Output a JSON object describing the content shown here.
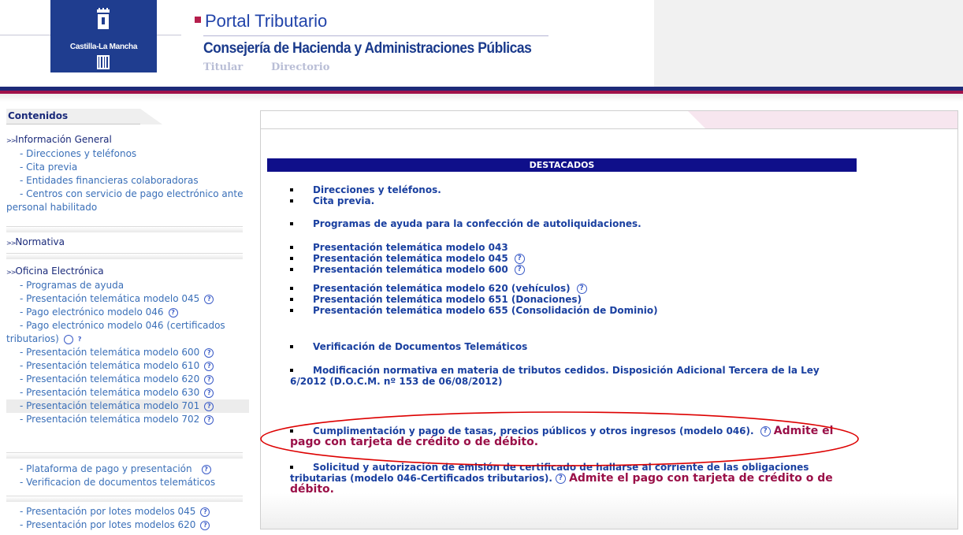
{
  "header": {
    "logo_text": "Castilla-La Mancha",
    "portal_title": "Portal Tributario",
    "subtitle": "Consejería de Hacienda y Administraciones Públicas",
    "nav": [
      "Titular",
      "Directorio"
    ]
  },
  "sidebar": {
    "title": "Contenidos",
    "groups": [
      {
        "heading": "Información General",
        "items": [
          {
            "label": "- Direcciones y teléfonos"
          },
          {
            "label": "- Cita previa"
          },
          {
            "label": "- Entidades financieras colaboradoras"
          },
          {
            "label": "- Centros con servicio de pago electrónico ante personal habilitado"
          }
        ]
      },
      {
        "heading": "Normativa",
        "items": []
      },
      {
        "heading": "Oficina Electrónica",
        "items": [
          {
            "label": "- Programas de ayuda"
          },
          {
            "label": "- Presentación telemática modelo 045"
          },
          {
            "label": "- Pago electrónico modelo 046"
          },
          {
            "label": "- Pago electrónico modelo 046 (certificados tributarios)"
          },
          {
            "label": "- Presentación telemática modelo 600"
          },
          {
            "label": "- Presentación telemática modelo 610"
          },
          {
            "label": "- Presentación telemática modelo 620"
          },
          {
            "label": "- Presentación telemática modelo 630"
          },
          {
            "label": "- Presentación telemática modelo 701"
          },
          {
            "label": "- Presentación telemática modelo 702"
          }
        ]
      },
      {
        "heading": "",
        "items": [
          {
            "label": "- Plataforma de pago y presentación"
          },
          {
            "label": "- Verificacion de documentos telemáticos"
          }
        ]
      },
      {
        "heading": "",
        "items": [
          {
            "label": "- Presentación por lotes modelos 045"
          },
          {
            "label": "- Presentación por lotes modelos 620"
          }
        ]
      }
    ]
  },
  "main": {
    "destacados": "DESTACADOS",
    "links": {
      "direcciones": "Direcciones y teléfonos.",
      "cita": "Cita previa.",
      "programas": "Programas de ayuda para la confección de autoliquidaciones.",
      "m043": "Presentación telemática modelo 043",
      "m045": "Presentación telemática modelo 045",
      "m600": "Presentación telemática modelo 600",
      "m620": "Presentación telemática modelo 620 (vehículos)",
      "m651": "Presentación telemática modelo 651 (Donaciones)",
      "m655": "Presentación telemática modelo 655 (Consolidación de Dominio)",
      "verificacion": "Verificación de Documentos Telemáticos",
      "modificacion": "Modificación normativa en materia de tributos cedidos. Disposición Adicional Tercera de la Ley 6/2012 (D.O.C.M. nº 153 de 06/08/2012)",
      "tasas": "Cumplimentación y pago de tasas, precios públicos y otros ingresos (modelo 046).",
      "tasas_note": "Admite el pago con tarjeta de crédito o de débito.",
      "solicitud": "Solicitud y autorización de emisión de certificado de hallarse al corriente de las obligaciones tributarias (modelo 046-Certificados tributarios).",
      "solicitud_note": "Admite el pago con tarjeta de crédito o de débito."
    }
  },
  "colors": {
    "brand_blue": "#1f3d8f",
    "navy_band": "#1e2a78",
    "magenta_band": "#a0124a",
    "destacados_bar": "#0f0f8a",
    "highlight_ellipse": "#dd0000"
  }
}
